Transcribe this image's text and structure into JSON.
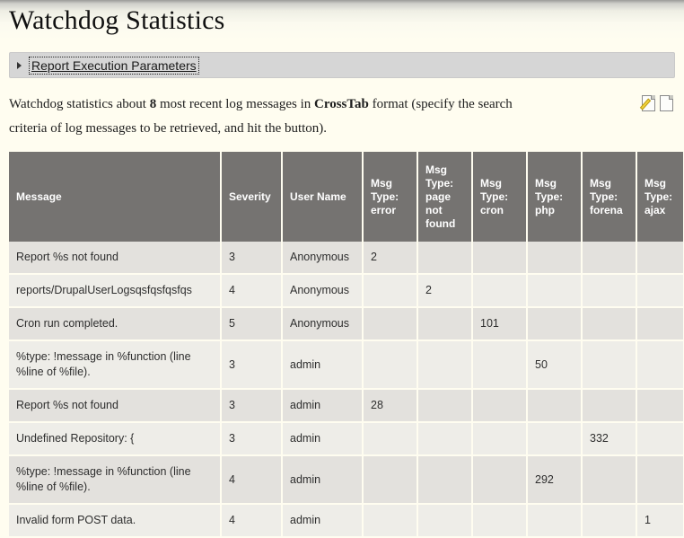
{
  "page": {
    "title": "Watchdog Statistics"
  },
  "fieldset": {
    "legend": "Report Execution Parameters",
    "arrow_icon": "triangle-right-icon"
  },
  "description": {
    "part1": "Watchdog statistics about ",
    "count": "8",
    "part2": " most recent log messages in ",
    "format": "CrossTab",
    "part3": " format (specify the search criteria of log messages to be retrieved, and hit the button).",
    "icons": [
      {
        "name": "edit-document-icon"
      },
      {
        "name": "new-document-icon"
      }
    ]
  },
  "table": {
    "columns": [
      "Message",
      "Severity",
      "User Name",
      "Msg Type: error",
      "Msg Type: page not found",
      "Msg Type: cron",
      "Msg Type: php",
      "Msg Type: forena",
      "Msg Type: ajax"
    ],
    "rows": [
      {
        "message": "Report %s not found",
        "severity": "3",
        "user": "Anonymous",
        "error": "2",
        "page_not_found": "",
        "cron": "",
        "php": "",
        "forena": "",
        "ajax": ""
      },
      {
        "message": "reports/DrupalUserLogsqsfqsfqsfqs",
        "severity": "4",
        "user": "Anonymous",
        "error": "",
        "page_not_found": "2",
        "cron": "",
        "php": "",
        "forena": "",
        "ajax": ""
      },
      {
        "message": "Cron run completed.",
        "severity": "5",
        "user": "Anonymous",
        "error": "",
        "page_not_found": "",
        "cron": "101",
        "php": "",
        "forena": "",
        "ajax": ""
      },
      {
        "message": "%type: !message in %function (line %line of %file).",
        "severity": "3",
        "user": "admin",
        "error": "",
        "page_not_found": "",
        "cron": "",
        "php": "50",
        "forena": "",
        "ajax": ""
      },
      {
        "message": "Report %s not found",
        "severity": "3",
        "user": "admin",
        "error": "28",
        "page_not_found": "",
        "cron": "",
        "php": "",
        "forena": "",
        "ajax": ""
      },
      {
        "message": "Undefined Repository: {",
        "severity": "3",
        "user": "admin",
        "error": "",
        "page_not_found": "",
        "cron": "",
        "php": "",
        "forena": "332",
        "ajax": ""
      },
      {
        "message": "%type: !message in %function (line %line of %file).",
        "severity": "4",
        "user": "admin",
        "error": "",
        "page_not_found": "",
        "cron": "",
        "php": "292",
        "forena": "",
        "ajax": ""
      },
      {
        "message": "Invalid form POST data.",
        "severity": "4",
        "user": "admin",
        "error": "",
        "page_not_found": "",
        "cron": "",
        "php": "",
        "forena": "",
        "ajax": "1"
      }
    ]
  },
  "colors": {
    "header_bg": "#757371",
    "row_odd": "#e3e1dd",
    "row_even": "#eeede8",
    "number": "#a0504d",
    "page_bg": "#fffdf0",
    "fieldset_bg": "#d6d6d6"
  }
}
